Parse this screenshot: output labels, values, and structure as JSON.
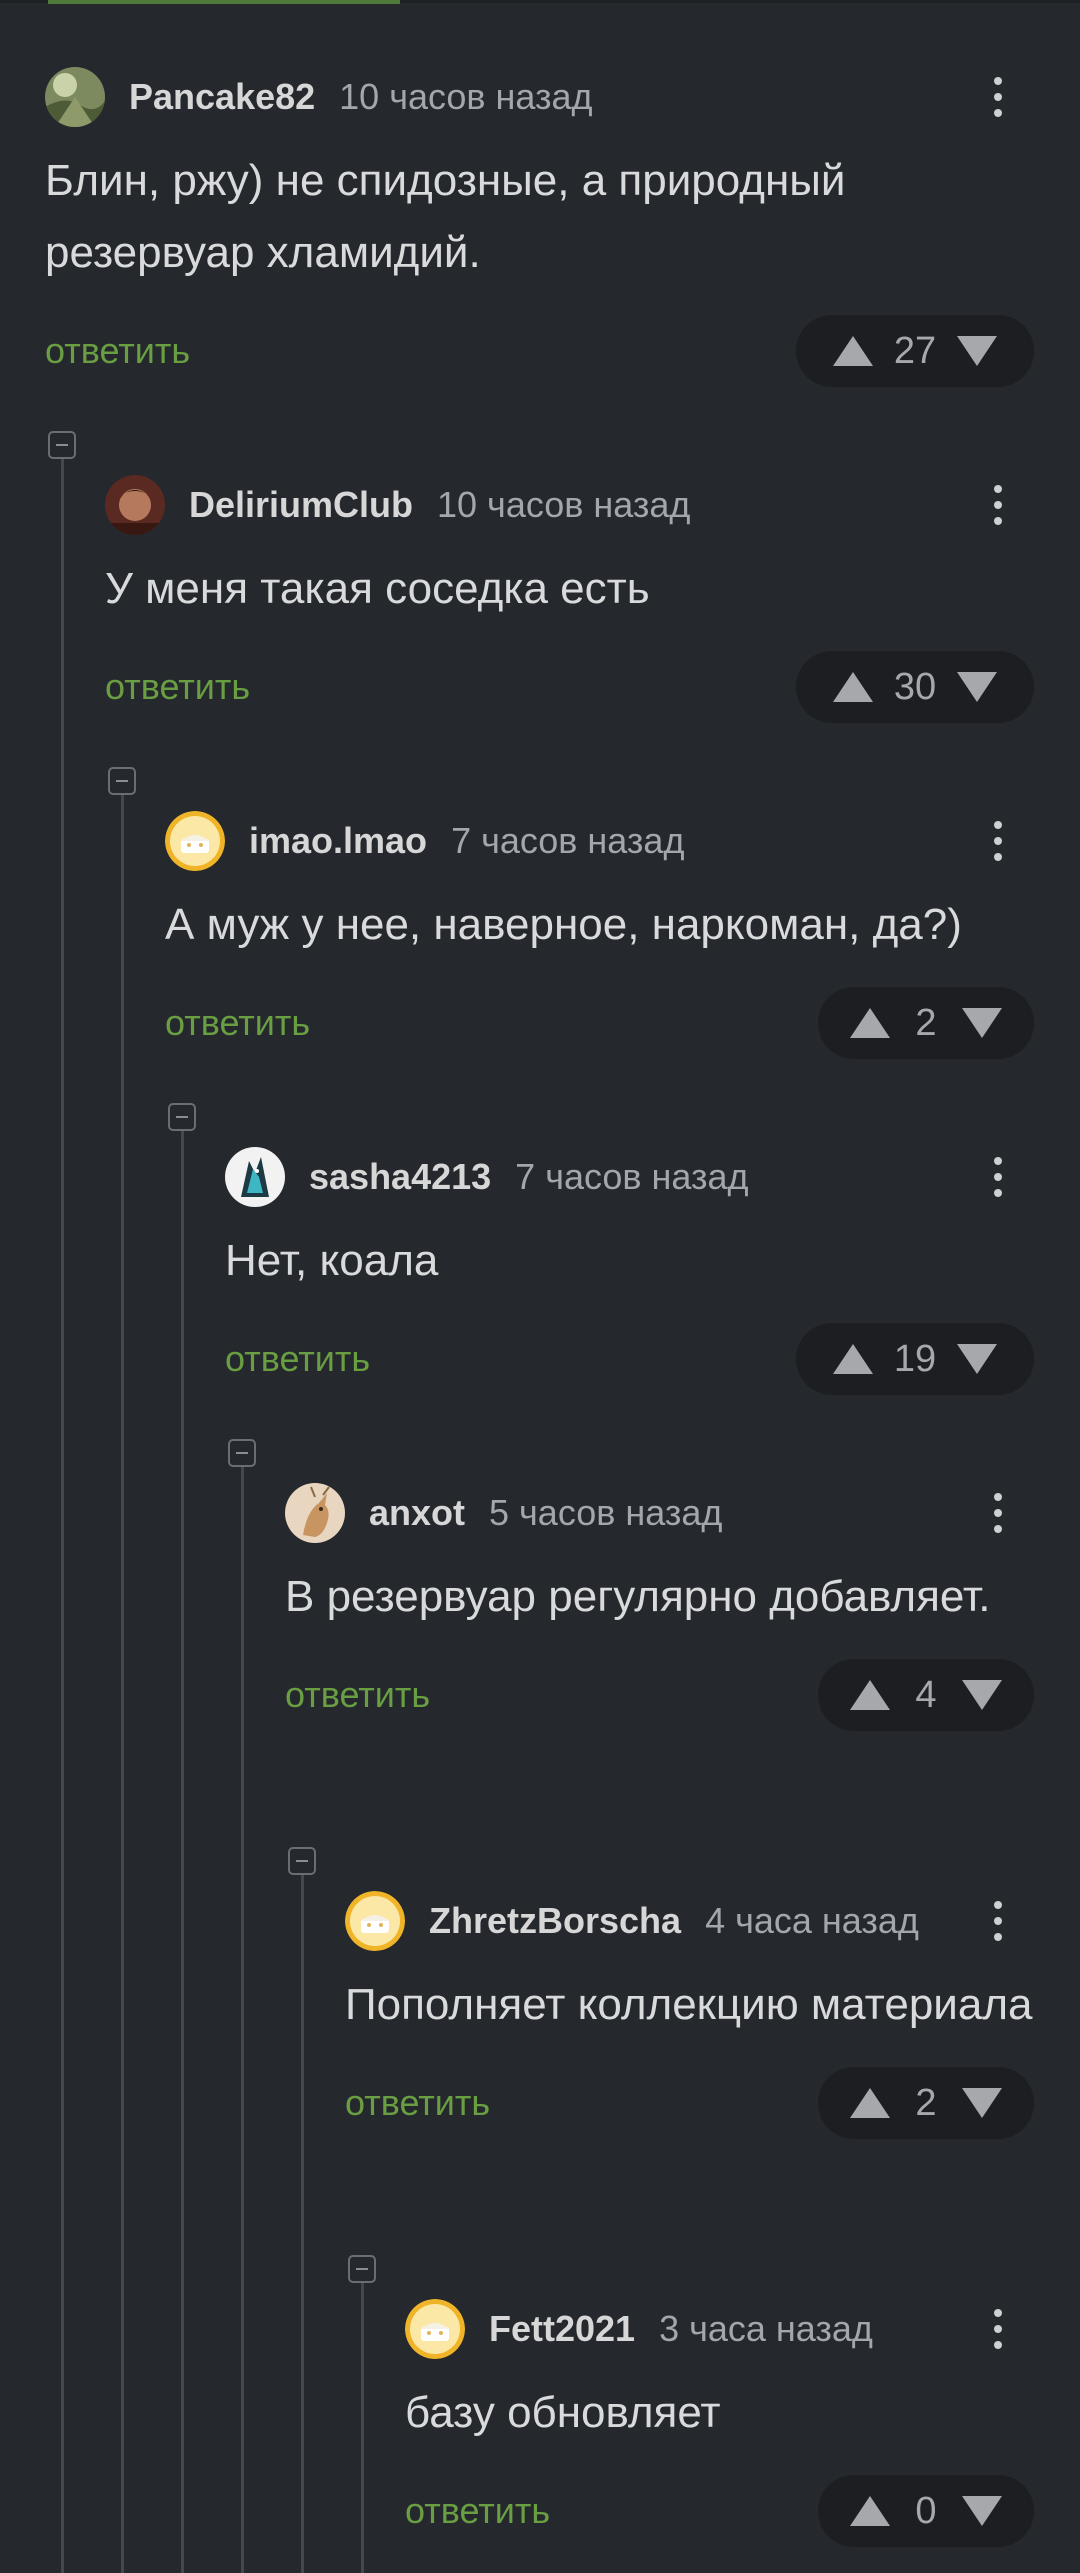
{
  "actions": {
    "reply_label": "ответить"
  },
  "comments": [
    {
      "username": "Pancake82",
      "time": "10 часов назад",
      "text": "Блин, ржу) не спидозные, а природный резервуар хламидий.",
      "votes": "27",
      "avatar": "landscape-avatar"
    },
    {
      "username": "DeliriumClub",
      "time": "10 часов назад",
      "text": "У меня такая соседка есть",
      "votes": "30",
      "avatar": "portrait-avatar"
    },
    {
      "username": "imao.lmao",
      "time": "7 часов назад",
      "text": "А муж у нее, наверное, наркоман, да?)",
      "votes": "2",
      "avatar": "default-cake-avatar"
    },
    {
      "username": "sasha4213",
      "time": "7 часов назад",
      "text": "Нет, коала",
      "votes": "19",
      "avatar": "dragon-avatar"
    },
    {
      "username": "anxot",
      "time": "5 часов назад",
      "text": "В резервуар регулярно добавляет.",
      "votes": "4",
      "avatar": "deer-avatar"
    },
    {
      "username": "ZhretzBorscha",
      "time": "4 часа назад",
      "text": "Пополняет коллекцию материала",
      "votes": "2",
      "avatar": "default-cake-avatar"
    },
    {
      "username": "Fett2021",
      "time": "3 часа назад",
      "text": "базу обновляет",
      "votes": "0",
      "avatar": "default-cake-avatar"
    }
  ],
  "colors": {
    "background": "#25282c",
    "reply_link": "#6a9e43",
    "accent_bar": "#4e7b3a",
    "vote_pill": "#1c1e21"
  }
}
